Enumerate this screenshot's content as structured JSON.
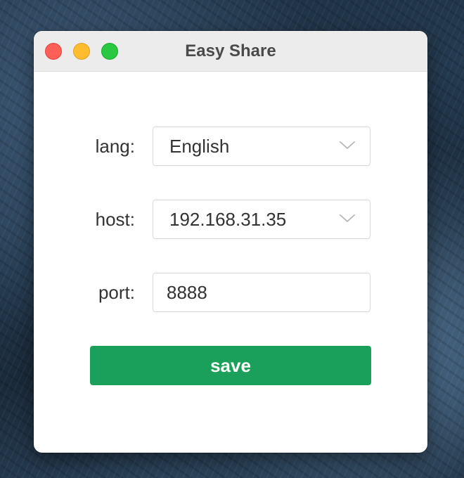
{
  "window": {
    "title": "Easy Share"
  },
  "form": {
    "lang": {
      "label": "lang:",
      "value": "English"
    },
    "host": {
      "label": "host:",
      "value": "192.168.31.35"
    },
    "port": {
      "label": "port:",
      "value": "8888"
    }
  },
  "actions": {
    "save_label": "save"
  },
  "colors": {
    "accent": "#1aa05a",
    "close": "#ff5f57",
    "minimize": "#febc2e",
    "maximize": "#28c840"
  },
  "icons": {
    "dropdown": "chevron-down-icon"
  }
}
